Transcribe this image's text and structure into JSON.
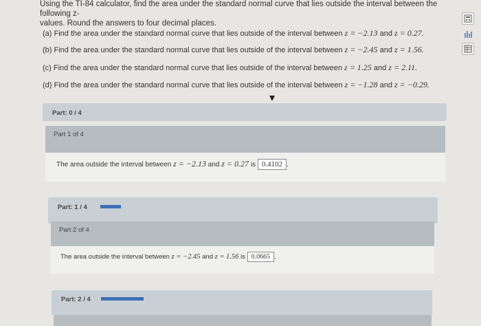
{
  "intro": {
    "line1": "Using the TI-84 calculator, find the area under the standard normal curve that lies outside the interval between the following z-",
    "line2": "values. Round the answers to four decimal places."
  },
  "questions": [
    {
      "label": "(a) Find the area under the standard normal curve that lies outside of the interval between",
      "z1": "z = −2.13",
      "z2": "z = 0.27."
    },
    {
      "label": "(b) Find the area under the standard normal curve that lies outside of the interval between",
      "z1": "z = −2.45",
      "z2": "z = 1.56."
    },
    {
      "label": "(c) Find the area under the standard normal curve that lies outside of the interval between",
      "z1": "z = 1.25",
      "z2": "z = 2.11."
    },
    {
      "label": "(d) Find the area under the standard normal curve that lies outside of the interval between",
      "z1": "z = −1.28",
      "z2": "z = −0.29."
    }
  ],
  "and_word": "and",
  "tools": {
    "top_icon": "calculator-icon",
    "mid_icon": "chart-icon",
    "bottom_icon": "table-icon"
  },
  "parts": [
    {
      "progress_label": "Part: 0 / 4",
      "progress_fraction": 0.0
    },
    {
      "progress_label": "Part: 1 / 4",
      "progress_fraction": 0.25
    },
    {
      "progress_label": "Part: 2 / 4",
      "progress_fraction": 0.5
    }
  ],
  "part1": {
    "header": "Part 1 of 4",
    "text": "The area outside the interval between",
    "z1": "z = −2.13",
    "and": "and",
    "z2": "z = 0.27",
    "is": "is",
    "answer": "0.4102",
    "period": "."
  },
  "part2": {
    "header": "Part 2 of 4",
    "text": "The area outside the interval between",
    "z1": "z = −2.45",
    "and": "and",
    "z2": "z = 1.56",
    "is": "is",
    "answer": "0.0665",
    "period": "."
  },
  "colors": {
    "accent": "#3f6fb7",
    "bar": "#c9d0d5",
    "header": "#b7bcc0",
    "background": "#e7e6e3"
  }
}
